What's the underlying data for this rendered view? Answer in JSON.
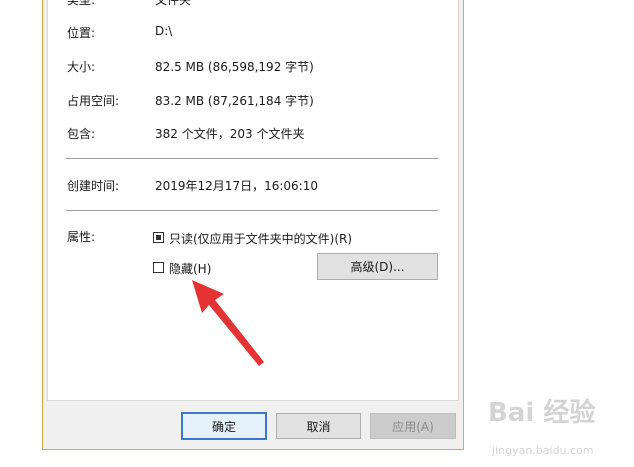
{
  "properties": {
    "type": {
      "label": "类型:",
      "value": "文件夹"
    },
    "location": {
      "label": "位置:",
      "value": "D:\\"
    },
    "size": {
      "label": "大小:",
      "value": "82.5 MB (86,598,192 字节)"
    },
    "size_on_disk": {
      "label": "占用空间:",
      "value": "83.2 MB (87,261,184 字节)"
    },
    "contains": {
      "label": "包含:",
      "value": "382 个文件，203 个文件夹"
    },
    "created": {
      "label": "创建时间:",
      "value": "2019年12月17日，16:06:10"
    },
    "attributes": {
      "label": "属性:",
      "readonly_label": "只读(仅应用于文件夹中的文件)(R)",
      "readonly_checked": true,
      "hidden_label": "隐藏(H)",
      "hidden_checked": false,
      "advanced_button": "高级(D)..."
    }
  },
  "footer": {
    "ok_label": "确定",
    "cancel_label": "取消",
    "apply_label": "应用(A)"
  },
  "watermark": {
    "brand": "Bai 经验",
    "url": "jingyan.baidu.com"
  },
  "colors": {
    "frame_border": "#e0a550",
    "arrow": "#e53333",
    "default_button_border": "#3b79c7"
  }
}
